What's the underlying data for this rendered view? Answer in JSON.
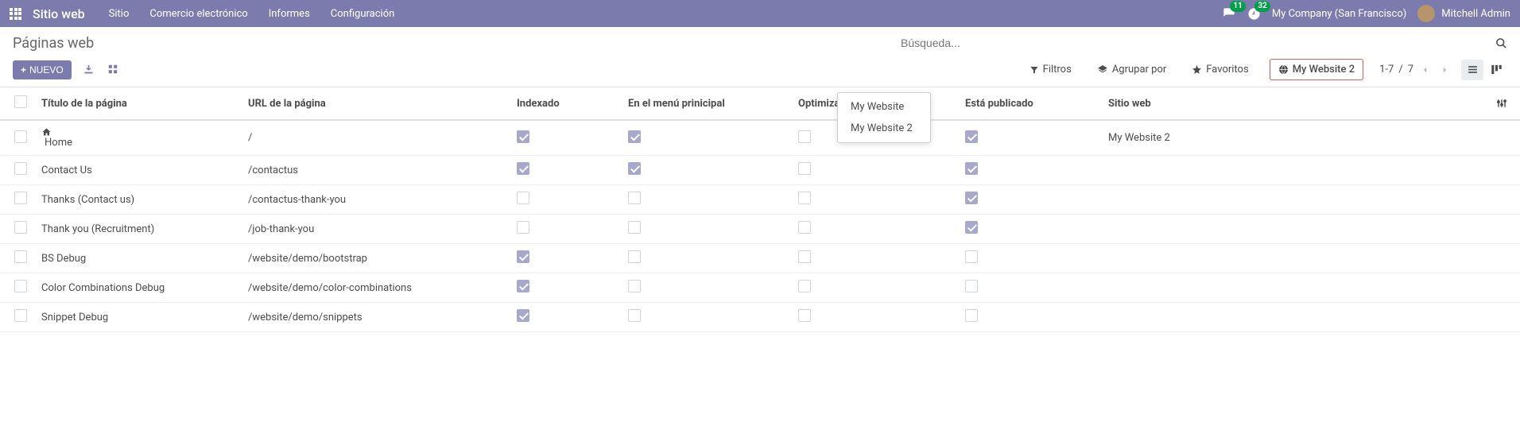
{
  "header": {
    "brand": "Sitio web",
    "nav": [
      "Sitio",
      "Comercio electrónico",
      "Informes",
      "Configuración"
    ],
    "chat_count": "11",
    "timer_count": "32",
    "company": "My Company (San Francisco)",
    "user": "Mitchell Admin"
  },
  "breadcrumb": {
    "title": "Páginas web"
  },
  "search": {
    "placeholder": "Búsqueda..."
  },
  "toolbar": {
    "new_btn": "NUEVO",
    "filters": "Filtros",
    "groupby": "Agrupar por",
    "favorites": "Favoritos",
    "website_filter": "My Website 2"
  },
  "dropdown": {
    "items": [
      "My Website",
      "My Website 2"
    ]
  },
  "pager": {
    "range": "1-7",
    "sep": "/",
    "total": "7"
  },
  "table": {
    "headers": {
      "title": "Título de la página",
      "url": "URL de la página",
      "indexed": "Indexado",
      "inmenu": "En el menú prinicipal",
      "seo": "Optimizado para SEO",
      "published": "Está publicado",
      "site": "Sitio web"
    },
    "rows": [
      {
        "title": "Home",
        "home": true,
        "url": "/",
        "indexed": true,
        "inmenu": true,
        "seo": false,
        "published": true,
        "site": "My Website 2"
      },
      {
        "title": "Contact Us",
        "url": "/contactus",
        "indexed": true,
        "inmenu": true,
        "seo": false,
        "published": true,
        "site": ""
      },
      {
        "title": "Thanks (Contact us)",
        "url": "/contactus-thank-you",
        "indexed": false,
        "inmenu": false,
        "seo": false,
        "published": true,
        "site": ""
      },
      {
        "title": "Thank you (Recruitment)",
        "url": "/job-thank-you",
        "indexed": false,
        "inmenu": false,
        "seo": false,
        "published": true,
        "site": ""
      },
      {
        "title": "BS Debug",
        "url": "/website/demo/bootstrap",
        "indexed": true,
        "inmenu": false,
        "seo": false,
        "published": false,
        "site": ""
      },
      {
        "title": "Color Combinations Debug",
        "url": "/website/demo/color-combinations",
        "indexed": true,
        "inmenu": false,
        "seo": false,
        "published": false,
        "site": ""
      },
      {
        "title": "Snippet Debug",
        "url": "/website/demo/snippets",
        "indexed": true,
        "inmenu": false,
        "seo": false,
        "published": false,
        "site": ""
      }
    ]
  }
}
